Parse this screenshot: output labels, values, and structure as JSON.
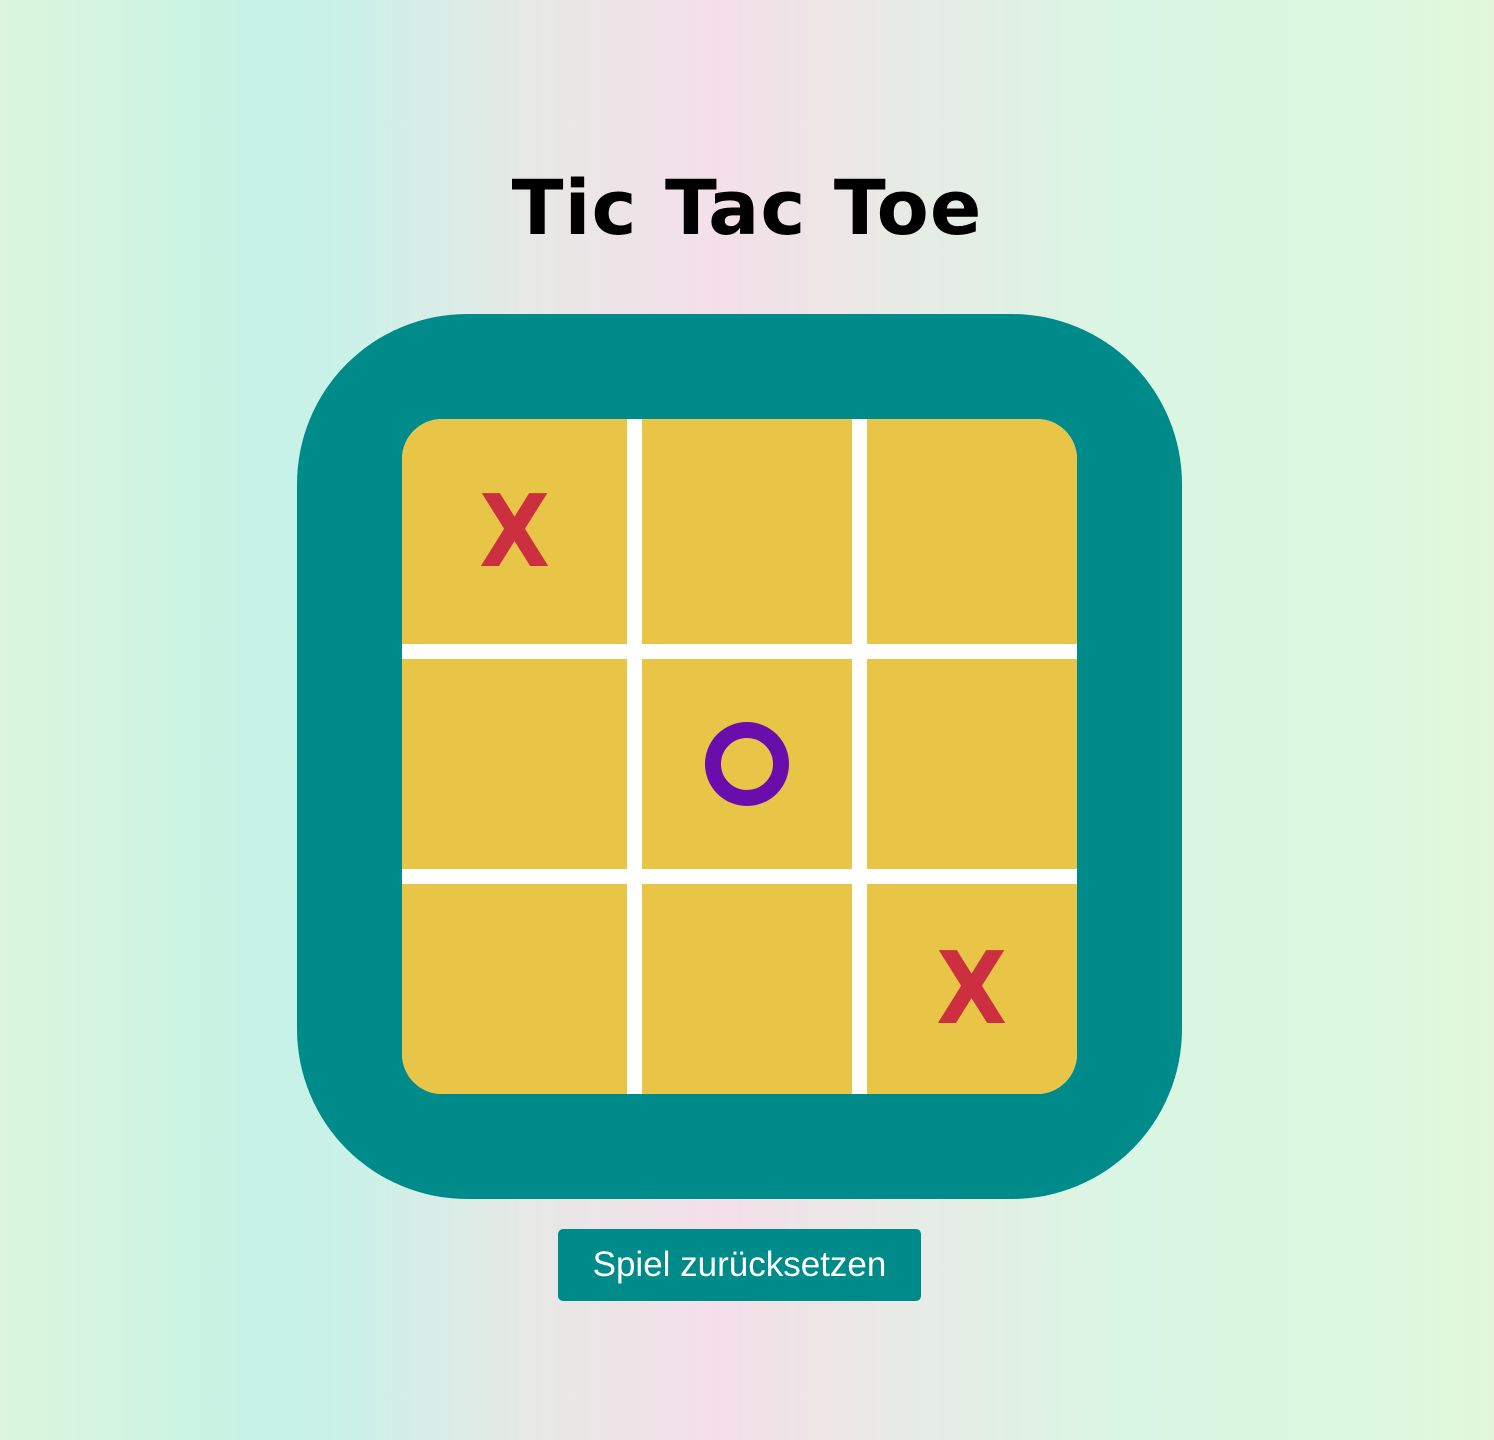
{
  "title": "Tic Tac Toe",
  "board": {
    "cells": [
      "X",
      "",
      "",
      "",
      "O",
      "",
      "",
      "",
      "X"
    ]
  },
  "reset_button_label": "Spiel zurücksetzen",
  "colors": {
    "frame": "#008b8b",
    "cell": "#e8c547",
    "grid_lines": "#ffffff",
    "x_mark": "#cc3040",
    "o_mark": "#6a0dad",
    "button": "#008b8b"
  }
}
